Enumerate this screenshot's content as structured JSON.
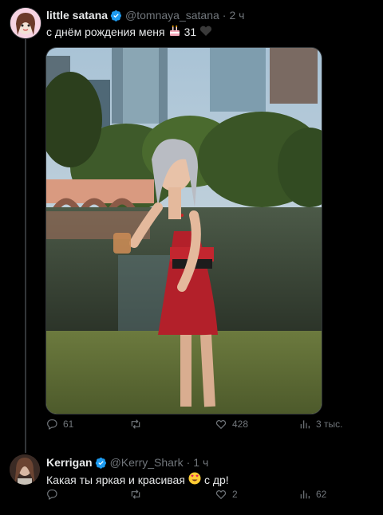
{
  "post": {
    "name": "little satana",
    "handle": "@tomnaya_satana",
    "dot": "·",
    "time": "2 ч",
    "text_before": "с днём рождения меня",
    "text_num": "31",
    "cake_icon": "cake-emoji",
    "heart_icon": "black-heart-emoji",
    "stats": {
      "replies": "61",
      "reposts": "",
      "likes": "428",
      "views": "3 тыс."
    }
  },
  "reply": {
    "name": "Kerrigan",
    "handle": "@Kerry_Shark",
    "dot": "·",
    "time": "1 ч",
    "text_before": "Какая ты яркая и красивая",
    "text_after": "с др!",
    "emoji_icon": "heart-eyes-emoji",
    "stats": {
      "replies": "",
      "reposts": "",
      "likes": "2",
      "views": "62"
    }
  },
  "colors": {
    "accent": "#1d9bf0",
    "muted": "#71767b",
    "text": "#e7e9ea",
    "divider": "#2f3336"
  }
}
